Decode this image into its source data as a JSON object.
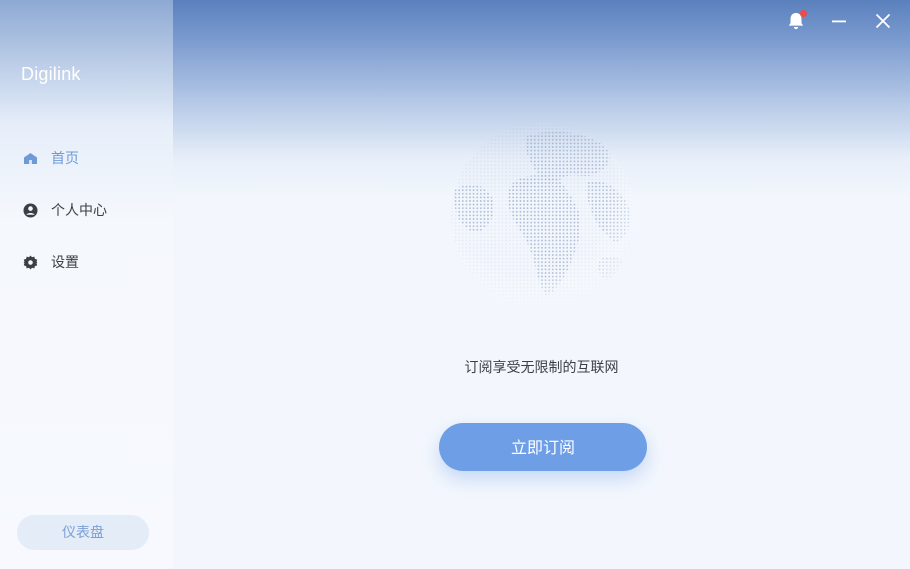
{
  "app": {
    "name": "Digilink"
  },
  "sidebar": {
    "items": [
      {
        "label": "首页",
        "icon": "home-icon",
        "active": true
      },
      {
        "label": "个人中心",
        "icon": "user-icon",
        "active": false
      },
      {
        "label": "设置",
        "icon": "gear-icon",
        "active": false
      }
    ],
    "dashboard_label": "仪表盘"
  },
  "titlebar": {
    "notification_icon": "bell-icon",
    "has_unread": true
  },
  "main": {
    "illustration": "globe-icon",
    "slogan": "订阅享受无限制的互联网",
    "subscribe_label": "立即订阅"
  },
  "colors": {
    "accent": "#6d9ee6",
    "active_nav": "#6f9ad8",
    "badge": "#f04b4b"
  }
}
